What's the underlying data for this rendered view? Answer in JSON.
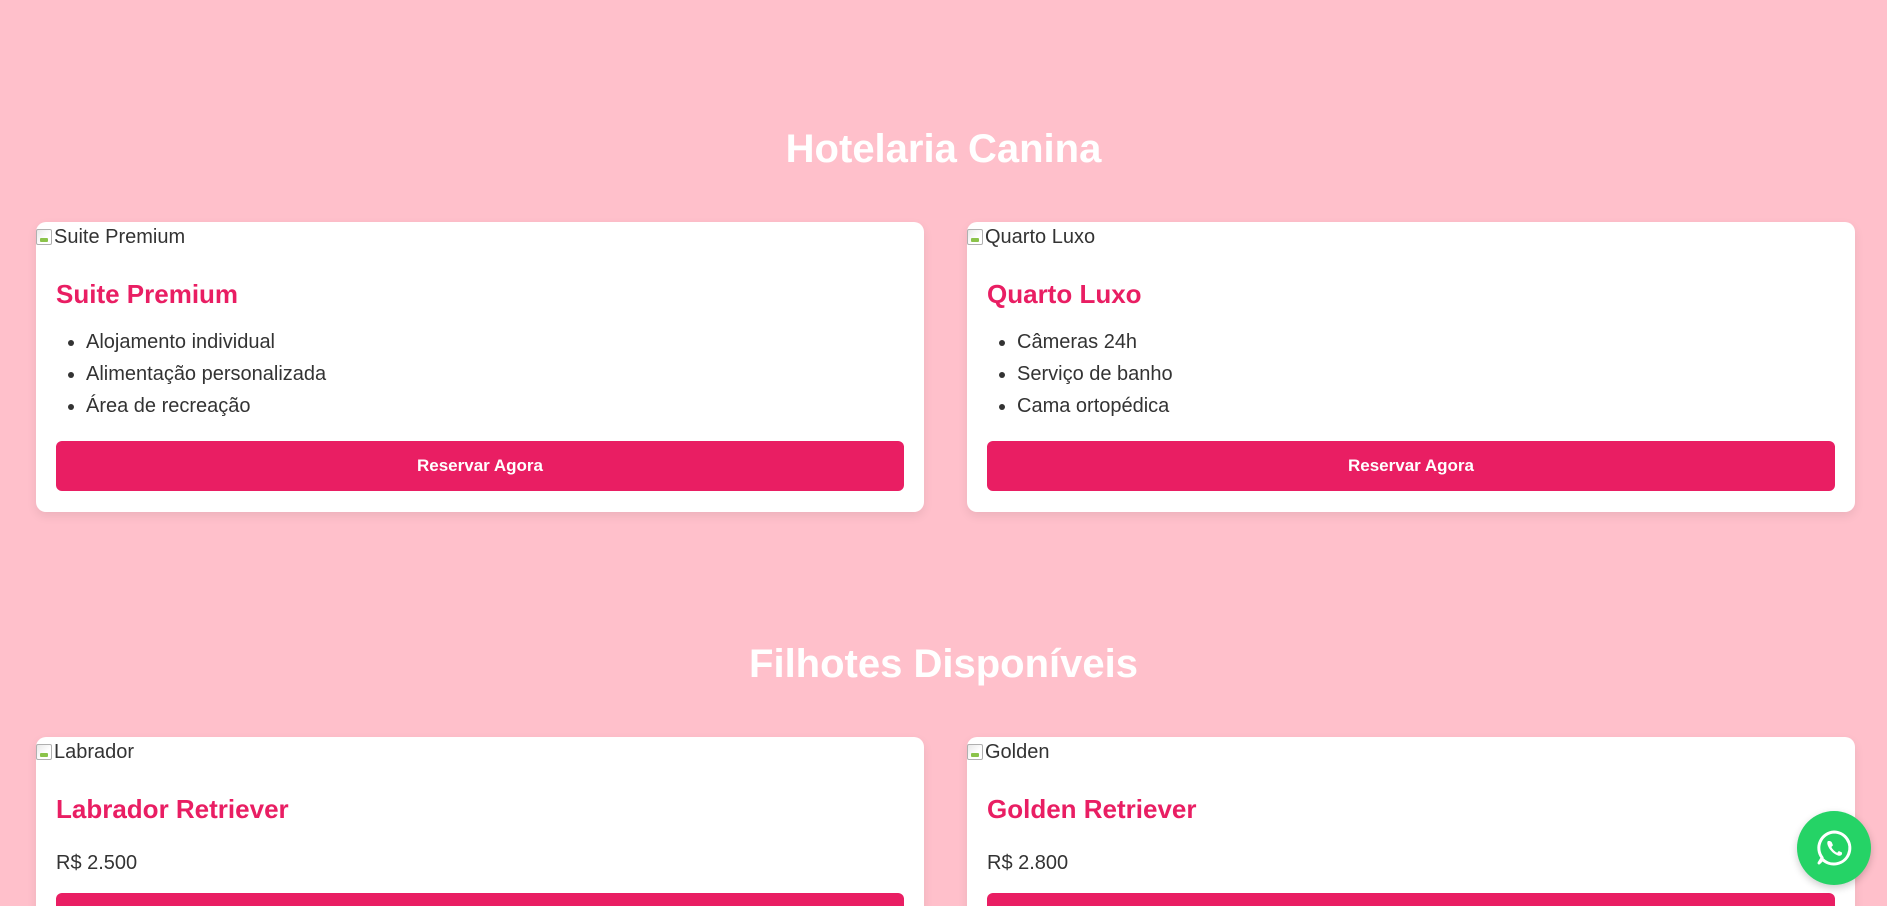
{
  "hotel": {
    "title": "Hotelaria Canina",
    "cards": [
      {
        "image_alt": "Suite Premium",
        "name": "Suite Premium",
        "features": [
          "Alojamento individual",
          "Alimentação personalizada",
          "Área de recreação"
        ],
        "button": "Reservar Agora"
      },
      {
        "image_alt": "Quarto Luxo",
        "name": "Quarto Luxo",
        "features": [
          "Câmeras 24h",
          "Serviço de banho",
          "Cama ortopédica"
        ],
        "button": "Reservar Agora"
      }
    ]
  },
  "puppies": {
    "title": "Filhotes Disponíveis",
    "cards": [
      {
        "image_alt": "Labrador",
        "name": "Labrador Retriever",
        "price": "R$ 2.500"
      },
      {
        "image_alt": "Golden",
        "name": "Golden Retriever",
        "price": "R$ 2.800"
      }
    ]
  },
  "whatsapp": {
    "icon": "whatsapp-icon"
  },
  "colors": {
    "background": "#ffc0cb",
    "accent": "#e91e63",
    "whatsapp": "#25d366"
  }
}
